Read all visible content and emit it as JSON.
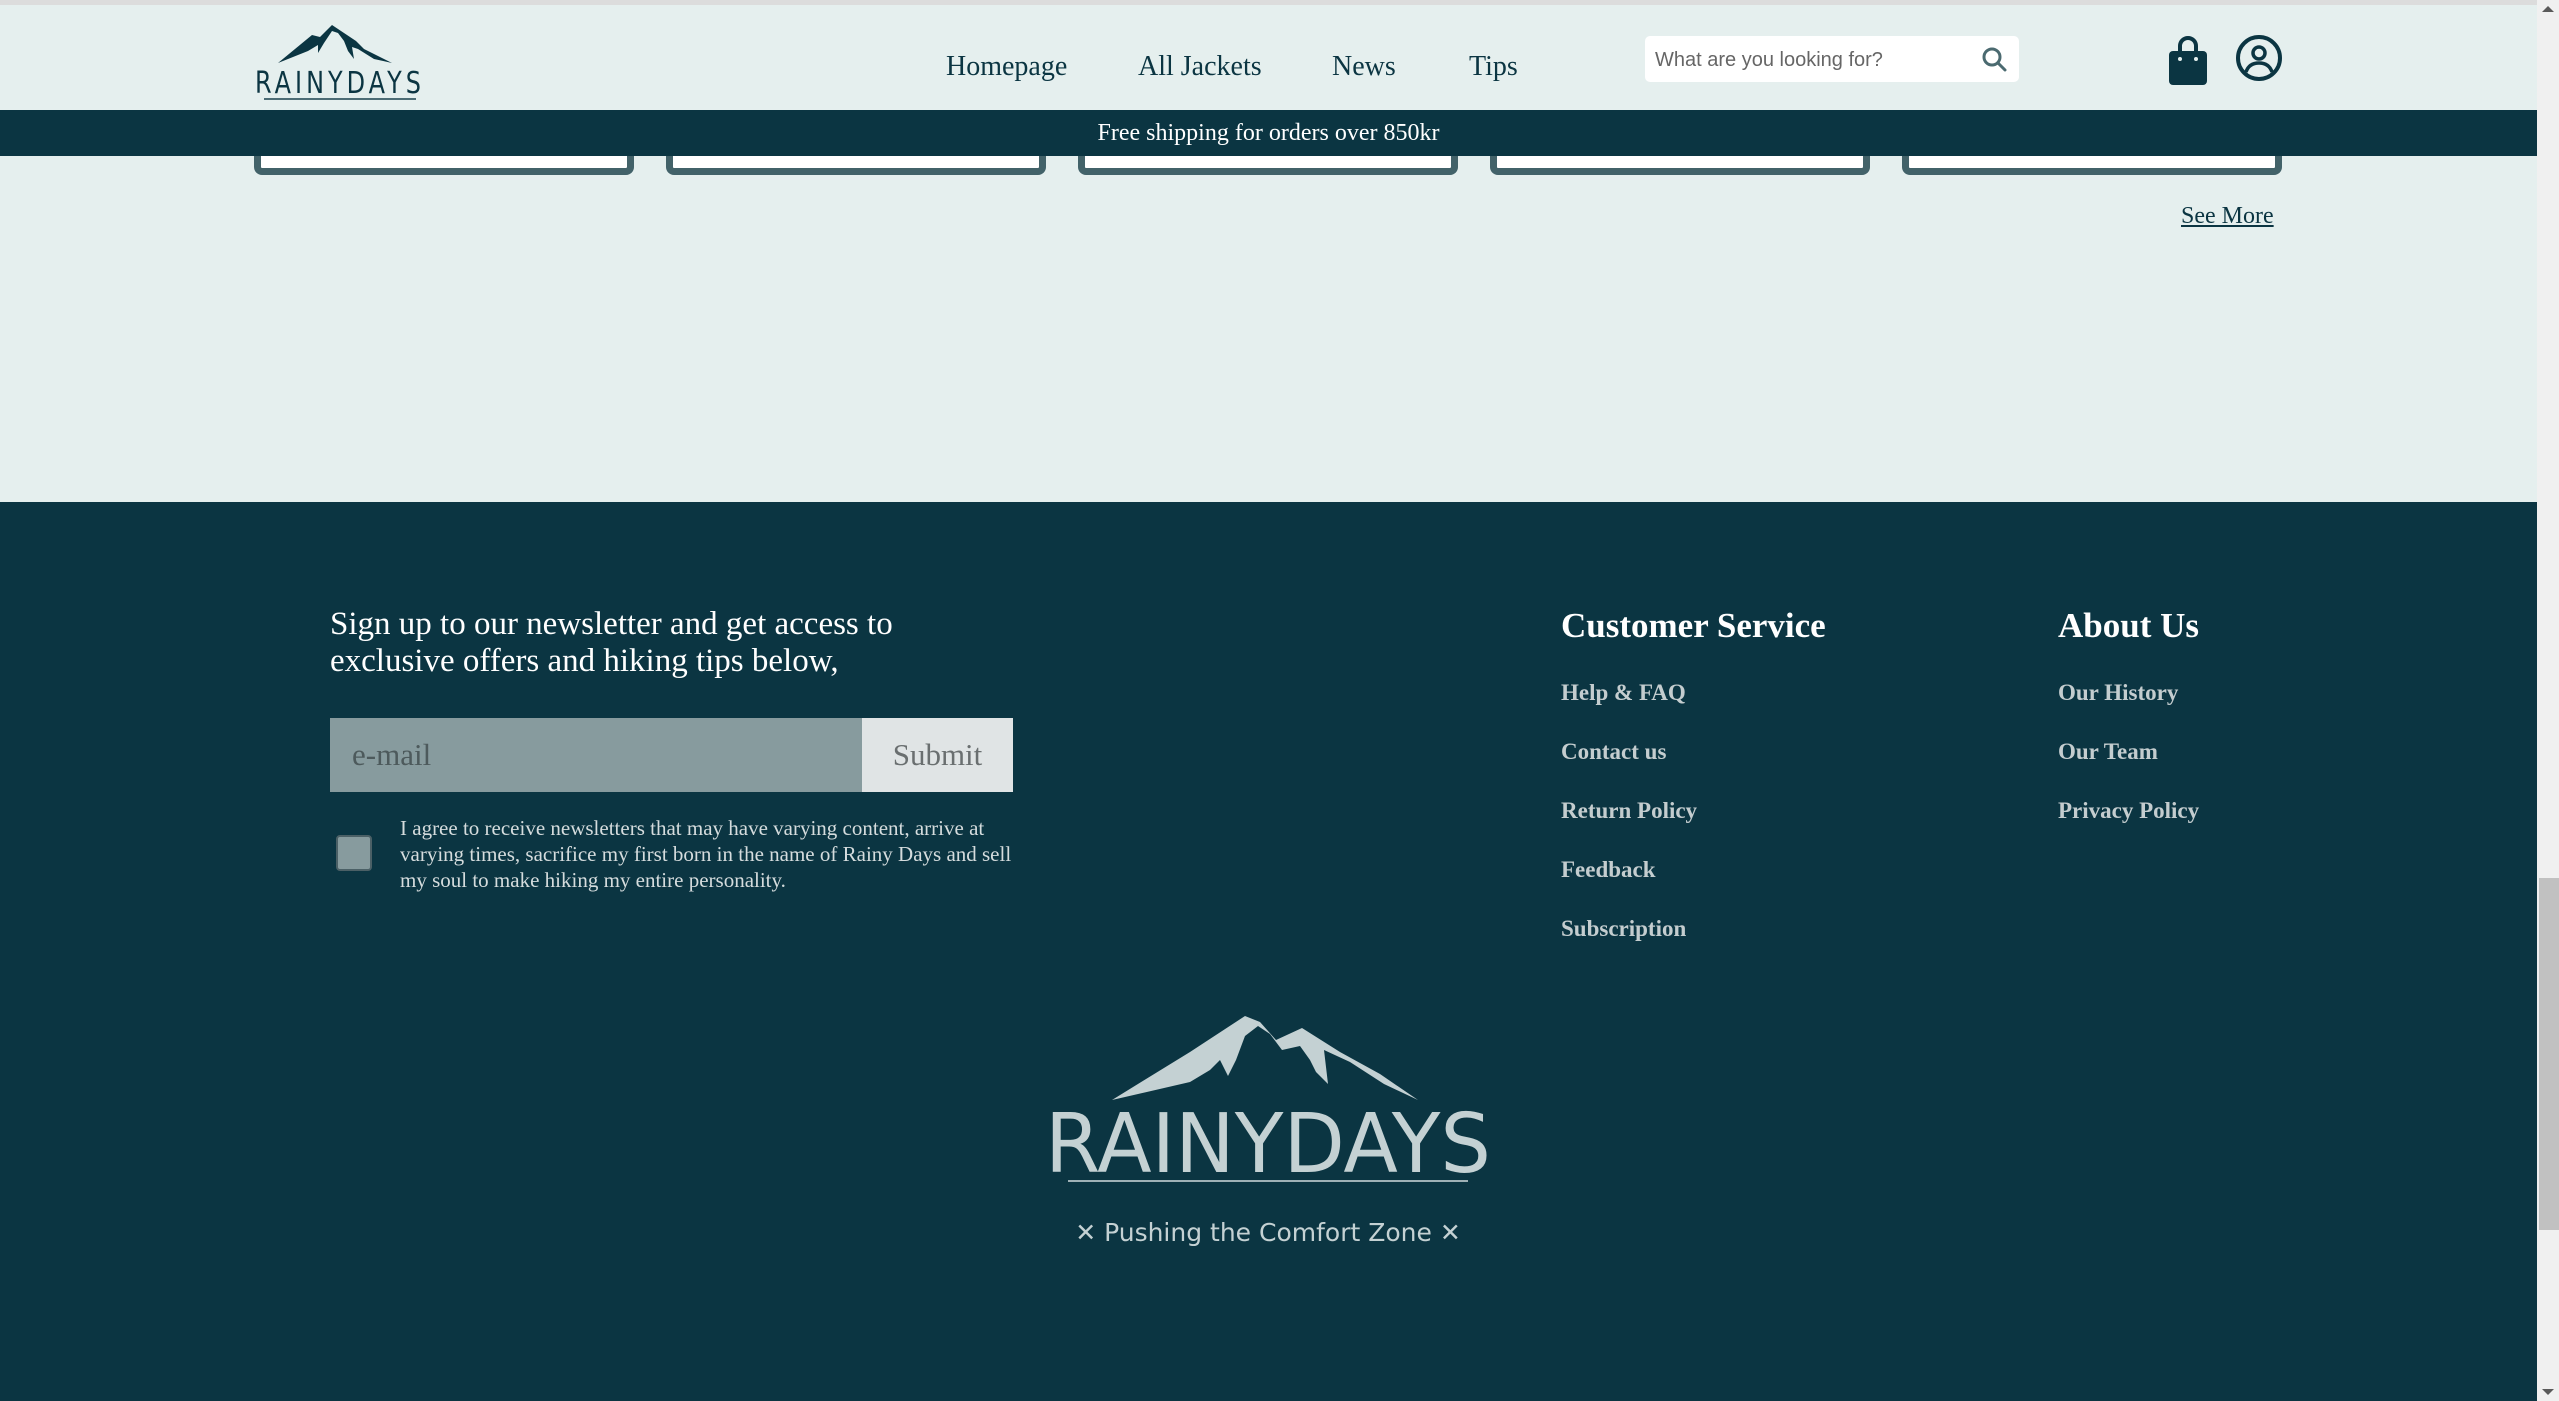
{
  "header": {
    "brand": "RAINYDAYS",
    "nav": [
      {
        "label": "Homepage"
      },
      {
        "label": "All Jackets"
      },
      {
        "label": "News"
      },
      {
        "label": "Tips"
      }
    ],
    "search": {
      "placeholder": "What are you looking for?",
      "value": ""
    },
    "icons": {
      "search": "search-icon",
      "cart": "shopping-bag-icon",
      "account": "user-circle-icon"
    }
  },
  "banner": {
    "text": "Free shipping for orders over 850kr"
  },
  "products": {
    "card_count": 5,
    "see_more_label": "See More"
  },
  "footer": {
    "newsletter": {
      "title": "Sign up to our newsletter and get access to exclusive offers and hiking tips below,",
      "email_placeholder": "e-mail",
      "email_value": "",
      "submit_label": "Submit",
      "agree_checked": false,
      "agree_text": "I agree to receive newsletters that may have varying content, arrive at varying times, sacrifice my first born in the name of Rainy Days and sell my soul to make hiking my entire personality."
    },
    "customer_service": {
      "title": "Customer Service",
      "links": [
        "Help & FAQ",
        "Contact us",
        "Return Policy",
        "Feedback",
        "Subscription"
      ]
    },
    "about_us": {
      "title": "About Us",
      "links": [
        "Our History",
        "Our Team",
        "Privacy Policy"
      ]
    },
    "brand": "RAINYDAYS",
    "tagline": "✕ Pushing the Comfort Zone ✕"
  },
  "colors": {
    "primary_dark": "#0b3542",
    "page_background": "#e5efee",
    "card_border": "#426269",
    "footer_link": "#c4cdcf",
    "logo_light": "#c4d1d3"
  }
}
